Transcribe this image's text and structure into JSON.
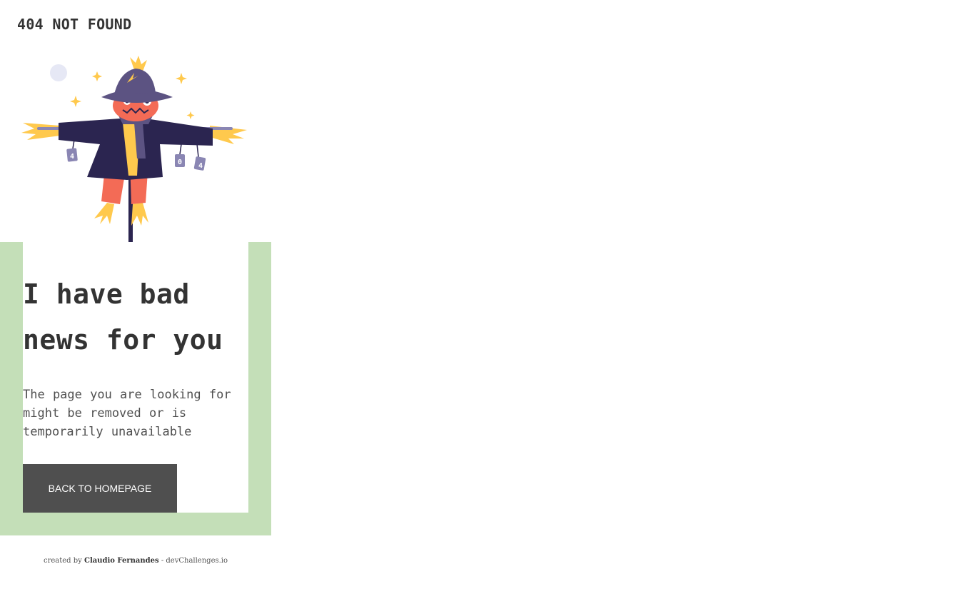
{
  "header": {
    "title": "404 NOT FOUND"
  },
  "illustration": {
    "icon": "scarecrow-illustration",
    "tag_left": "4",
    "tag_middle": "0",
    "tag_right": "4"
  },
  "content": {
    "headline": "I have bad news for you",
    "message": "The page you are looking for might be removed or is temporarily unavailable"
  },
  "button": {
    "label": "BACK TO HOMEPAGE"
  },
  "footer": {
    "prefix": "created by",
    "author": "Claudio Fernandes",
    "separator": "-",
    "site": "devChallenges.io"
  },
  "colors": {
    "frame_green": "#c4dfb8",
    "button_bg": "#4f4f4f",
    "text_dark": "#333333",
    "scarecrow_purple": "#5c5382",
    "scarecrow_orange": "#f36b56",
    "straw_yellow": "#ffc94d",
    "coat_navy": "#2b2550"
  }
}
